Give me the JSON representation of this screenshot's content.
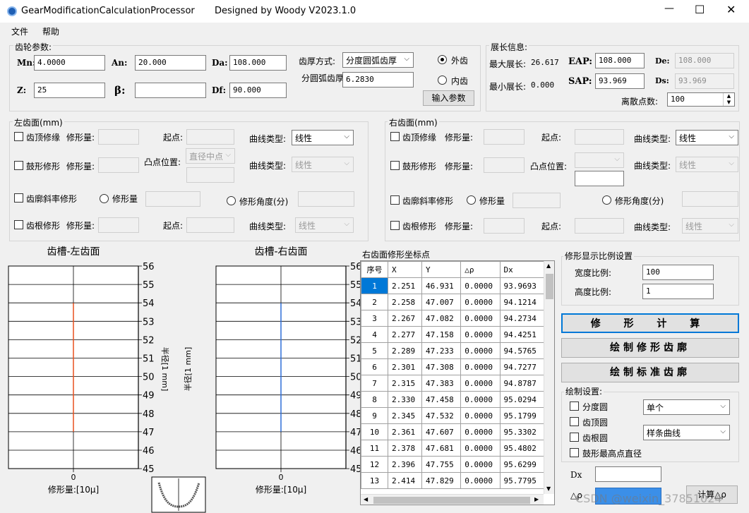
{
  "window": {
    "title": "GearModificationCalculationProcessor",
    "designed_by": "Designed by Woody  V2023.1.0",
    "controls": [
      "—",
      "☐",
      "✕"
    ]
  },
  "menu": [
    "文件",
    "帮助"
  ],
  "gear_params": {
    "title": "齿轮参数:",
    "mn_label": "Mn:",
    "mn": "4.0000",
    "an_label": "An:",
    "an": "20.000",
    "da_label": "Da:",
    "da": "108.000",
    "z_label": "Z:",
    "z": "25",
    "beta_label": "β:",
    "beta": "",
    "df_label": "Df:",
    "df": "90.000",
    "thickness_mode_label": "齿厚方式:",
    "thickness_mode": "分度圆弧齿厚",
    "arc_thickness_label": "分圆弧齿厚",
    "arc_thickness": "6.2830",
    "external": "外齿",
    "internal": "内齿",
    "input_button": "输入参数"
  },
  "extension_info": {
    "title": "展长信息:",
    "max_label": "最大展长:",
    "max_value": "26.617",
    "min_label": "最小展长:",
    "min_value": "0.000",
    "eap_label": "EAP:",
    "eap": "108.000",
    "sap_label": "SAP:",
    "sap": "93.969",
    "de_label": "De:",
    "de": "108.000",
    "ds_label": "Ds:",
    "ds": "93.969",
    "points_label": "离散点数:",
    "points": "100"
  },
  "left_flank": {
    "title": "左齿面(mm)",
    "tip_relief": "齿顶修缘",
    "amount": "修形量:",
    "start": "起点:",
    "curve_type": "曲线类型:",
    "tip_curve": "线性",
    "crowning": "鼓形修形",
    "crown_pos_label": "凸点位置:",
    "crown_pos": "直径中点",
    "crown_curve": "线性",
    "helix_slope": "齿廓斜率修形",
    "slope_amount": "修形量",
    "slope_angle": "修形角度(分)",
    "root_relief": "齿根修形",
    "root_curve": "线性"
  },
  "right_flank": {
    "title": "右齿面(mm)",
    "tip_relief": "齿顶修缘",
    "amount": "修形量:",
    "start": "起点:",
    "curve_type": "曲线类型:",
    "tip_curve": "线性",
    "crowning": "鼓形修形",
    "crown_pos_label": "凸点位置:",
    "crown_pos": "",
    "crown_curve": "线性",
    "helix_slope": "齿廓斜率修形",
    "slope_amount": "修形量",
    "slope_angle": "修形角度(分)",
    "root_relief": "齿根修形",
    "root_curve": "线性"
  },
  "charts": {
    "left_title": "齿槽-左齿面",
    "right_title": "齿槽-右齿面",
    "y_label": "半径[1 mm]",
    "x_label": "修形量:[10μ]",
    "x_tick": "0",
    "y_ticks": [
      "56",
      "55",
      "54",
      "53",
      "52",
      "51",
      "50",
      "49",
      "48",
      "47",
      "46",
      "45"
    ],
    "left_color": "#e8501e",
    "right_color": "#2e6fd8",
    "profile_fraction": {
      "from": 47,
      "to": 54
    }
  },
  "coords": {
    "title": "右齿面修形坐标点",
    "headers": [
      "序号",
      "X",
      "Y",
      "△ρ",
      "Dx"
    ],
    "rows": [
      [
        "1",
        "2.251",
        "46.931",
        "0.0000",
        "93.9693"
      ],
      [
        "2",
        "2.258",
        "47.007",
        "0.0000",
        "94.1214"
      ],
      [
        "3",
        "2.267",
        "47.082",
        "0.0000",
        "94.2734"
      ],
      [
        "4",
        "2.277",
        "47.158",
        "0.0000",
        "94.4251"
      ],
      [
        "5",
        "2.289",
        "47.233",
        "0.0000",
        "94.5765"
      ],
      [
        "6",
        "2.301",
        "47.308",
        "0.0000",
        "94.7277"
      ],
      [
        "7",
        "2.315",
        "47.383",
        "0.0000",
        "94.8787"
      ],
      [
        "8",
        "2.330",
        "47.458",
        "0.0000",
        "95.0294"
      ],
      [
        "9",
        "2.345",
        "47.532",
        "0.0000",
        "95.1799"
      ],
      [
        "10",
        "2.361",
        "47.607",
        "0.0000",
        "95.3302"
      ],
      [
        "11",
        "2.378",
        "47.681",
        "0.0000",
        "95.4802"
      ],
      [
        "12",
        "2.396",
        "47.755",
        "0.0000",
        "95.6299"
      ],
      [
        "13",
        "2.414",
        "47.829",
        "0.0000",
        "95.7795"
      ]
    ]
  },
  "scale": {
    "title": "修形显示比例设置",
    "width_label": "宽度比例:",
    "width": "100",
    "height_label": "高度比例:",
    "height": "1"
  },
  "actions": {
    "calc": "修 形 计 算",
    "draw_mod": "绘制修形齿廓",
    "draw_std": "绘制标准齿廓"
  },
  "draw_settings": {
    "title": "绘制设置:",
    "pitch_circle": "分度圆",
    "tip_circle": "齿顶圆",
    "root_circle": "齿根圆",
    "crown_diameter": "鼓形最高点直径",
    "mode": "单个",
    "curve": "样条曲线"
  },
  "bottom": {
    "dx_label": "Dx",
    "drho_label": "△ρ",
    "calc_button": "计算△ρ",
    "watermark": "CSDN @weixin_37851024"
  }
}
